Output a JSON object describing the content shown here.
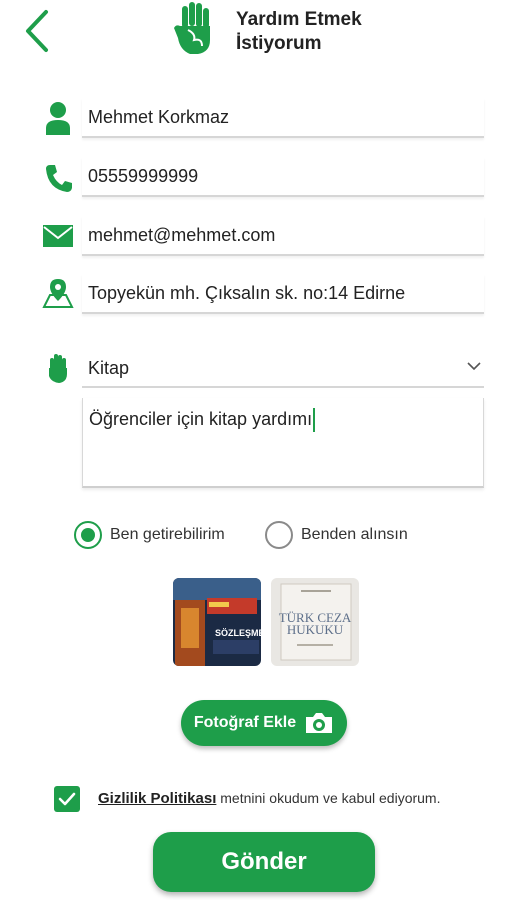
{
  "header": {
    "title_line1": "Yardım Etmek",
    "title_line2": "İstiyorum",
    "back_icon": "back-arrow-icon",
    "logo_icon": "helping-hand-icon"
  },
  "form": {
    "name": {
      "value": "Mehmet Korkmaz",
      "icon": "person-icon"
    },
    "phone": {
      "value": "05559999999",
      "icon": "phone-icon"
    },
    "email": {
      "value": "mehmet@mehmet.com",
      "icon": "mail-icon"
    },
    "address": {
      "value": "Topyekün mh. Çıksalın sk. no:14 Edirne",
      "icon": "map-pin-icon"
    },
    "category": {
      "value": "Kitap",
      "icon": "hand-icon"
    },
    "description": {
      "value": "Öğrenciler için kitap yardımı"
    }
  },
  "delivery": {
    "options": [
      {
        "label": "Ben getirebilirim",
        "selected": true
      },
      {
        "label": "Benden alınsın",
        "selected": false
      }
    ]
  },
  "photos": {
    "thumb1_text": "SÖZLEŞMEL",
    "thumb2_line1": "TÜRK CEZA",
    "thumb2_line2": "HUKUKU",
    "add_label": "Fotoğraf Ekle"
  },
  "consent": {
    "checked": true,
    "link_text": "Gizlilik Politikası",
    "rest_text": "metnini okudum ve kabul ediyorum."
  },
  "submit_label": "Gönder",
  "colors": {
    "accent": "#1e9e4a",
    "divider": "#d6d6d6"
  }
}
